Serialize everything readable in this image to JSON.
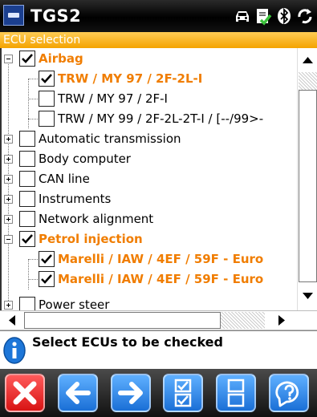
{
  "app": {
    "title": "TGS2"
  },
  "status_icons": [
    "car-icon",
    "notepad-check-icon",
    "bluetooth-icon",
    "sync-icon"
  ],
  "header": {
    "section_title": "ECU selection"
  },
  "colors": {
    "accent": "#f4a300",
    "highlight_text": "#f07d00",
    "button_blue": "#2a86e8",
    "button_red": "#e62020"
  },
  "tree": {
    "items": [
      {
        "label": "Airbag",
        "checked": true,
        "expand": "minus",
        "highlight": true
      },
      {
        "label": "TRW / MY 97 / 2F-2L-I",
        "checked": true,
        "highlight": true
      },
      {
        "label": "TRW / MY 97 / 2F-I",
        "checked": false,
        "highlight": false
      },
      {
        "label": "TRW / MY 99 / 2F-2L-2T-I / [--/99>-",
        "checked": false,
        "highlight": false
      },
      {
        "label": "Automatic transmission",
        "checked": false,
        "expand": "plus"
      },
      {
        "label": "Body computer",
        "checked": false,
        "expand": "plus"
      },
      {
        "label": "CAN line",
        "checked": false,
        "expand": "plus"
      },
      {
        "label": "Instruments",
        "checked": false,
        "expand": "plus"
      },
      {
        "label": "Network alignment",
        "checked": false,
        "expand": "plus"
      },
      {
        "label": "Petrol injection",
        "checked": true,
        "expand": "minus",
        "highlight": true
      },
      {
        "label": "Marelli / IAW / 4EF / 59F - Euro",
        "checked": true,
        "highlight": true
      },
      {
        "label": "Marelli / IAW / 4EF / 59F - Euro",
        "checked": true,
        "highlight": true
      },
      {
        "label": "Power steer",
        "checked": false,
        "expand": "plus"
      }
    ]
  },
  "info": {
    "message": "Select ECUs to be checked"
  },
  "toolbar": {
    "buttons": [
      "close-icon",
      "back-arrow-icon",
      "forward-arrow-icon",
      "select-all-icon",
      "deselect-all-icon",
      "help-icon"
    ]
  }
}
